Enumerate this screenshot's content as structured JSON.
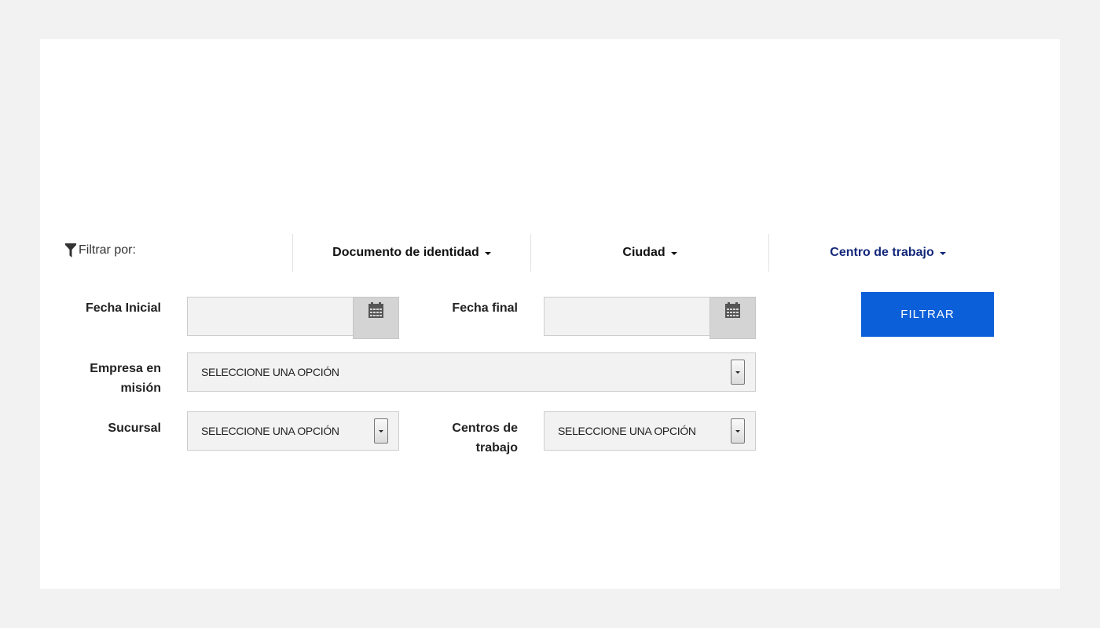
{
  "filter_bar": {
    "label": "Filtrar por:",
    "icon": "funnel-icon",
    "options": [
      {
        "label": "Documento de identidad",
        "active": false
      },
      {
        "label": "Ciudad",
        "active": false
      },
      {
        "label": "Centro de trabajo",
        "active": true
      }
    ],
    "active_color": "#14287a"
  },
  "form": {
    "fecha_inicial": {
      "label": "Fecha Inicial",
      "value": "",
      "icon": "calendar-icon"
    },
    "fecha_final": {
      "label": "Fecha final",
      "value": "",
      "icon": "calendar-icon"
    },
    "empresa": {
      "label_line1": "Empresa en",
      "label_line2": "misión",
      "selected": "SELECCIONE UNA OPCIÓN"
    },
    "sucursal": {
      "label": "Sucursal",
      "selected": "SELECCIONE UNA OPCIÓN"
    },
    "centros": {
      "label_line1": "Centros de",
      "label_line2": "trabajo",
      "selected": "SELECCIONE UNA OPCIÓN"
    }
  },
  "actions": {
    "filter_label": "FILTRAR",
    "filter_color": "#0b5fd9"
  }
}
